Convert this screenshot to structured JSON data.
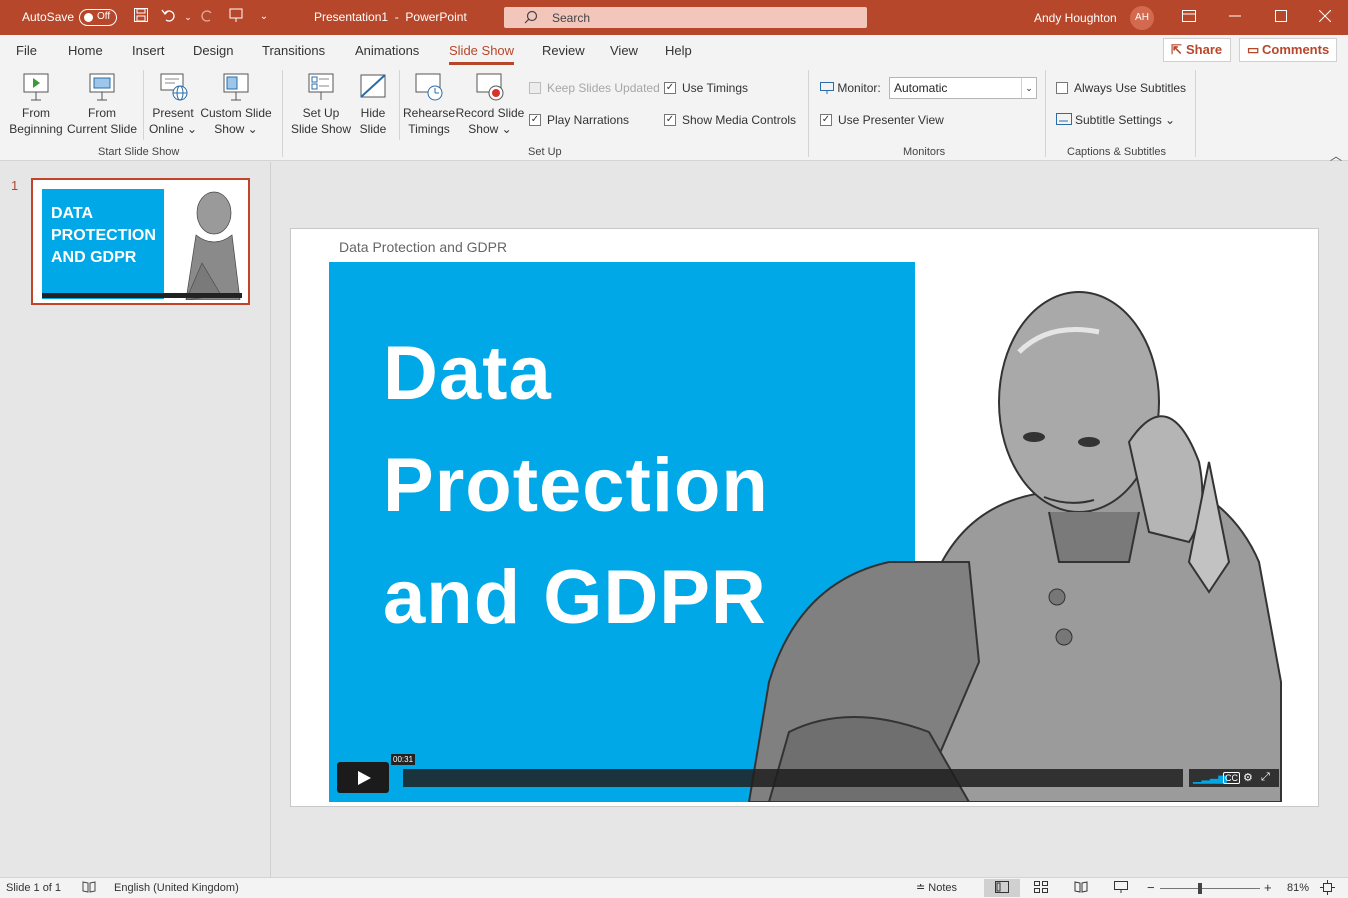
{
  "titlebar": {
    "autosave_label": "AutoSave",
    "autosave_state": "Off",
    "document": "Presentation1",
    "separator": "-",
    "app": "PowerPoint",
    "search_placeholder": "Search",
    "user_name": "Andy Houghton",
    "user_initials": "AH",
    "accent_color": "#b7472a"
  },
  "tabs": [
    "File",
    "Home",
    "Insert",
    "Design",
    "Transitions",
    "Animations",
    "Slide Show",
    "Review",
    "View",
    "Help"
  ],
  "active_tab": "Slide Show",
  "share_label": "Share",
  "comments_label": "Comments",
  "ribbon": {
    "from_beginning": [
      "From",
      "Beginning"
    ],
    "from_current": [
      "From",
      "Current Slide"
    ],
    "present_online": [
      "Present",
      "Online ⌄"
    ],
    "custom_show": [
      "Custom Slide",
      "Show ⌄"
    ],
    "group_start": "Start Slide Show",
    "set_up": [
      "Set Up",
      "Slide Show"
    ],
    "hide_slide": [
      "Hide",
      "Slide"
    ],
    "rehearse": [
      "Rehearse",
      "Timings"
    ],
    "record": [
      "Record Slide",
      "Show ⌄"
    ],
    "keep_updated": "Keep Slides Updated",
    "play_narrations": "Play Narrations",
    "use_timings": "Use Timings",
    "show_media": "Show Media Controls",
    "group_setup": "Set Up",
    "monitor_label": "Monitor:",
    "monitor_value": "Automatic",
    "presenter_view": "Use Presenter View",
    "group_monitors": "Monitors",
    "always_subtitles": "Always Use Subtitles",
    "subtitle_settings": "Subtitle Settings ⌄",
    "group_captions": "Captions & Subtitles"
  },
  "thumbnail": {
    "number": "1"
  },
  "slide": {
    "caption": "Data Protection and GDPR",
    "title_lines": [
      "Data",
      "Protection",
      "and GDPR"
    ],
    "video_time": "00:31",
    "blue_color": "#00a8e8"
  },
  "status": {
    "slide_info": "Slide 1 of 1",
    "language": "English (United Kingdom)",
    "notes": "Notes",
    "zoom": "81%"
  }
}
